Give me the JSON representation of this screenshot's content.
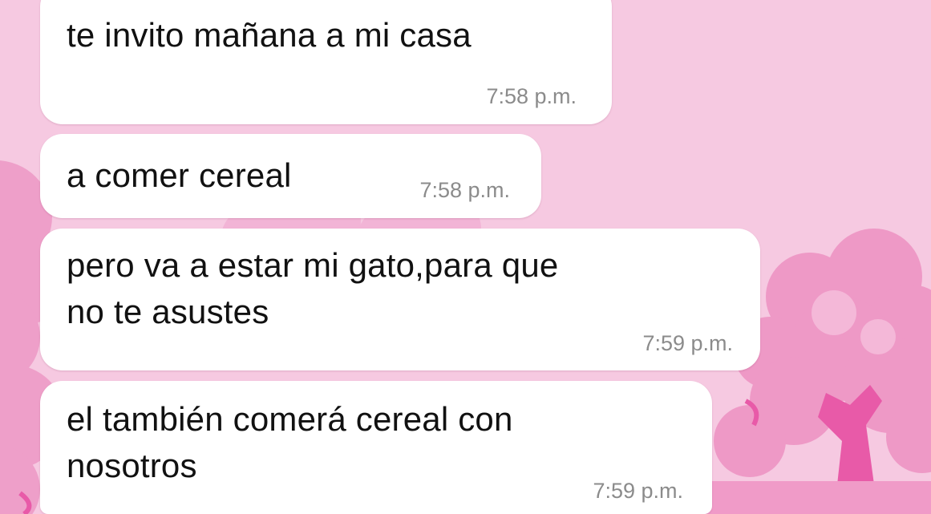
{
  "wallpaper": {
    "background_color": "#f6c9e1",
    "tree_color": "#ec9bc6",
    "trunk_color": "#e85aa8"
  },
  "messages": [
    {
      "text": "te invito mañana a mi casa",
      "time": "7:58 p.m."
    },
    {
      "text": "a comer cereal",
      "time": "7:58 p.m."
    },
    {
      "text": "pero va a estar mi gato,para que\nno te asustes",
      "time": "7:59 p.m."
    },
    {
      "text": "el también comerá cereal con\nnosotros",
      "time": "7:59 p.m."
    }
  ]
}
